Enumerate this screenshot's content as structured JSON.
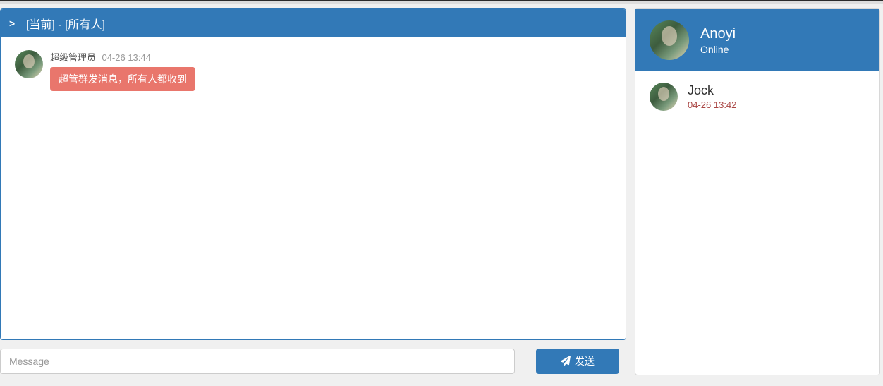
{
  "header": {
    "title": "[当前] - [所有人]"
  },
  "messages": [
    {
      "sender": "超级管理员",
      "time": "04-26 13:44",
      "content": "超管群发消息，所有人都收到"
    }
  ],
  "compose": {
    "placeholder": "Message",
    "send_label": "发送"
  },
  "profile": {
    "name": "Anoyi",
    "status": "Online"
  },
  "contacts": [
    {
      "name": "Jock",
      "time": "04-26 13:42"
    }
  ]
}
